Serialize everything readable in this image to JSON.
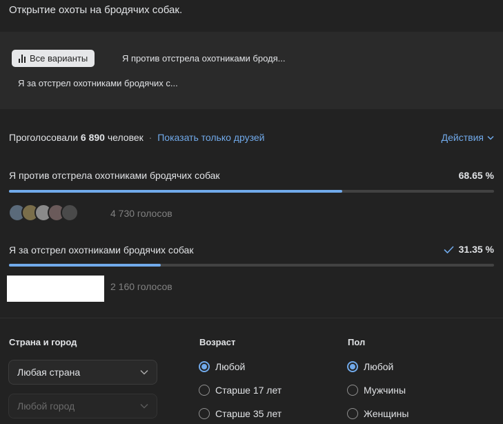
{
  "poll": {
    "title": "Открытие охоты на бродячих собак."
  },
  "tabs": {
    "all_label": "Все варианты",
    "option1_label": "Я против отстрела охотниками бродя...",
    "option2_label": "Я за отстрел охотниками бродячих с..."
  },
  "summary": {
    "voted_prefix": "Проголосовали",
    "voted_count": "6 890",
    "voted_suffix": "человек",
    "separator": "·",
    "friends_link": "Показать только друзей",
    "actions_label": "Действия"
  },
  "options": [
    {
      "label": "Я против отстрела охотниками бродячих собак",
      "percent": "68.65 %",
      "fraction": 0.6865,
      "votes": "4 730 голосов",
      "voted_by_me": false
    },
    {
      "label": "Я за отстрел охотниками бродячих собак",
      "percent": "31.35 %",
      "fraction": 0.3135,
      "votes": "2 160 голосов",
      "voted_by_me": true
    }
  ],
  "avatar_colors": [
    "#5a6a7a",
    "#7a6e4a",
    "#8a8a8a",
    "#6a5a5a",
    "#4a4a4a"
  ],
  "filters": {
    "location": {
      "heading": "Страна и город",
      "country_value": "Любая страна",
      "city_value": "Любой город"
    },
    "age": {
      "heading": "Возраст",
      "options": [
        "Любой",
        "Старше 17 лет",
        "Старше 35 лет"
      ],
      "selected": 0
    },
    "gender": {
      "heading": "Пол",
      "options": [
        "Любой",
        "Мужчины",
        "Женщины"
      ],
      "selected": 0
    }
  },
  "colors": {
    "accent": "#71aaeb",
    "background": "#222222",
    "track": "#424242"
  }
}
